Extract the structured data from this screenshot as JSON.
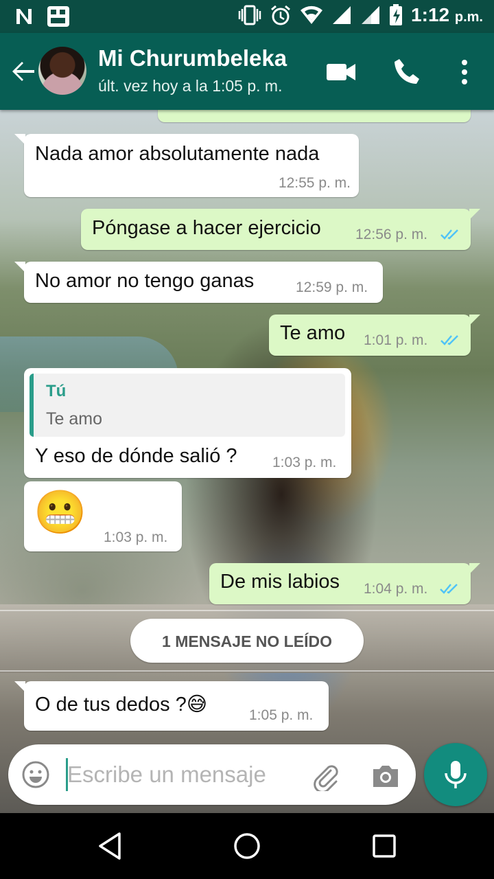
{
  "status_bar": {
    "time": "1:12",
    "ampm": "p.m.",
    "icons": [
      "n-icon",
      "gallery-icon",
      "vibrate-icon",
      "alarm-icon",
      "wifi-icon",
      "signal-icon",
      "signal-icon",
      "battery-charging-icon"
    ]
  },
  "header": {
    "contact_name": "Mi Churumbeleka",
    "last_seen": "últ. vez hoy a la 1:05 p. m.",
    "icons": [
      "back-arrow-icon",
      "video-call-icon",
      "phone-icon",
      "more-options-icon"
    ]
  },
  "messages": [
    {
      "dir": "in",
      "text": "Nada amor absolutamente nada",
      "time": "12:55 p. m."
    },
    {
      "dir": "out",
      "text": "Póngase a hacer ejercicio",
      "time": "12:56 p. m.",
      "read": true
    },
    {
      "dir": "in",
      "text": "No amor no tengo ganas",
      "time": "12:59 p. m."
    },
    {
      "dir": "out",
      "text": "Te amo",
      "time": "1:01 p. m.",
      "read": true
    },
    {
      "dir": "in",
      "quote_author": "Tú",
      "quote_text": "Te amo",
      "text": "Y eso de dónde salió ?",
      "time": "1:03 p. m."
    },
    {
      "dir": "in",
      "text": "😬",
      "time": "1:03 p. m."
    },
    {
      "dir": "out",
      "text": "De mis labios",
      "time": "1:04 p. m.",
      "read": true
    },
    {
      "dir": "in",
      "text": "O de tus dedos ?😅",
      "time": "1:05 p. m."
    }
  ],
  "unread_banner": "1 MENSAJE NO LEÍDO",
  "composer": {
    "placeholder": "Escribe un mensaje",
    "value": "",
    "icons": [
      "emoji-icon",
      "attach-icon",
      "camera-icon",
      "mic-icon"
    ]
  },
  "nav": {
    "icons": [
      "back-icon",
      "home-icon",
      "recents-icon"
    ]
  },
  "colors": {
    "header": "#075e54",
    "status_bar": "#0b4d43",
    "outgoing_bubble": "#dcf8c6",
    "incoming_bubble": "#ffffff",
    "accent": "#128c7e",
    "read_ticks": "#4fc3f7"
  }
}
